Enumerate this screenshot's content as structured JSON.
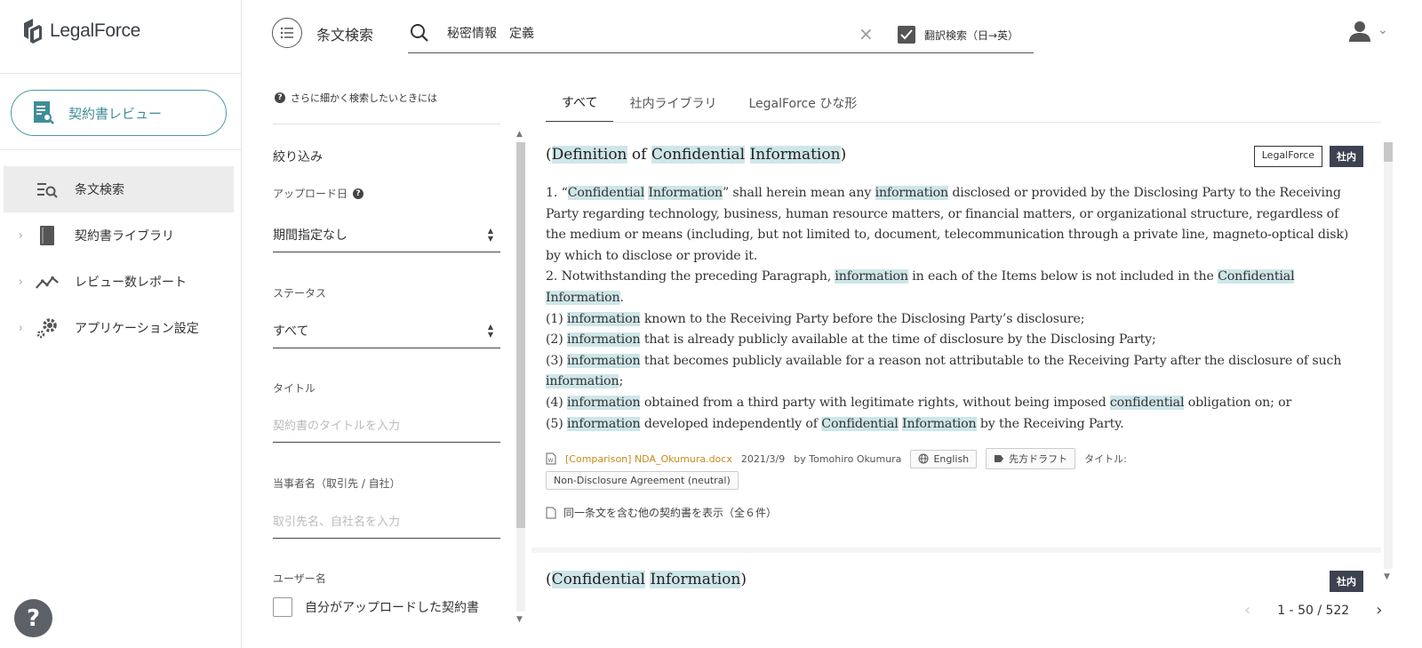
{
  "app": {
    "logo_text": "LegalForce"
  },
  "sidebar": {
    "review_button": "契約書レビュー",
    "items": [
      {
        "label": "条文検索",
        "active": true,
        "icon": "clause-search-icon"
      },
      {
        "label": "契約書ライブラリ",
        "active": false,
        "icon": "book-icon"
      },
      {
        "label": "レビュー数レポート",
        "active": false,
        "icon": "chart-line-icon"
      },
      {
        "label": "アプリケーション設定",
        "active": false,
        "icon": "gear-icon"
      }
    ],
    "help": "?"
  },
  "header": {
    "page_title": "条文検索",
    "search_value": "秘密情報　定義",
    "translate_label": "翻訳検索（日→英）",
    "translate_checked": true
  },
  "filters": {
    "hint": "さらに細かく検索したいときには",
    "heading": "絞り込み",
    "upload_date_label": "アップロード日",
    "upload_date_value": "期間指定なし",
    "status_label": "ステータス",
    "status_value": "すべて",
    "title_label": "タイトル",
    "title_placeholder": "契約書のタイトルを入力",
    "party_label": "当事者名（取引先 / 自社）",
    "party_placeholder": "取引先名、自社名を入力",
    "user_label": "ユーザー名",
    "own_uploads_label": "自分がアップロードした契約書"
  },
  "tabs": [
    {
      "label": "すべて",
      "active": true
    },
    {
      "label": "社内ライブラリ",
      "active": false
    },
    {
      "label": "LegalForce ひな形",
      "active": false
    }
  ],
  "results": [
    {
      "title": {
        "p1": "(",
        "h1": "Definition",
        "p2": " of ",
        "h2": "Confidential",
        "p3": " ",
        "h3": "Information",
        "p4": ")"
      },
      "badge_outline": "LegalForce",
      "badge_dark": "社内",
      "clause": {
        "l1a": "1. “",
        "l1h1": "Confidential",
        "l1b": " ",
        "l1h2": "Information",
        "l1c": "” shall herein mean any ",
        "l1h3": "information",
        "l1d": " disclosed or provided by the Disclosing Party to the Receiving Party regarding technology, business,  human resource matters, or financial matters, or organizational structure, regardless of the medium or means (including, but not limited to, document, telecommunication through a private line, magneto-optical disk) by which  to disclose or provide it.",
        "l2a": "2. Notwithstanding the preceding Paragraph, ",
        "l2h1": "information",
        "l2b": " in each of the Items below is not included in the ",
        "l2h2": "Confidential Information",
        "l2c": ".",
        "i1a": "(1)  ",
        "i1h": "information",
        "i1b": " known to the Receiving Party before the Disclosing Party’s disclosure;",
        "i2a": "(2) ",
        "i2h": "information",
        "i2b": " that is already publicly available at the time of disclosure by the Disclosing Party;",
        "i3a": "(3) ",
        "i3h": "information",
        "i3b": " that becomes publicly available for a reason not attributable to the Receiving Party after the disclosure of such ",
        "i3h2": "information",
        "i3c": ";",
        "i4a": "(4) ",
        "i4h": "information",
        "i4b": " obtained from a third party with legitimate rights, without being imposed ",
        "i4h2": "confidential",
        "i4c": " obligation on; or",
        "i5a": "(5) ",
        "i5h": "information",
        "i5b": " developed independently of ",
        "i5h2": "Confidential",
        "i5c": " ",
        "i5h3": "Information",
        "i5d": " by the Receiving Party."
      },
      "doc_name": "[Comparison] NDA_Okumura.docx",
      "date": "2021/3/9",
      "author": "by Tomohiro Okumura",
      "language": "English",
      "tag": "先方ドラフト",
      "title_label": "タイトル:",
      "title_value": "Non-Disclosure Agreement (neutral)",
      "same_clause_link": "同一条文を含む他の契約書を表示（全６件）"
    },
    {
      "title": {
        "p1": "(",
        "h1": "Confidential",
        "p2": " ",
        "h2": "Information",
        "p3": ")"
      },
      "badge_dark": "社内"
    }
  ],
  "pagination": {
    "range": "1 - 50 / 522"
  },
  "colors": {
    "accent": "#4a9ca6",
    "highlight": "#cfe6e9",
    "doc_link": "#c98a1a"
  }
}
